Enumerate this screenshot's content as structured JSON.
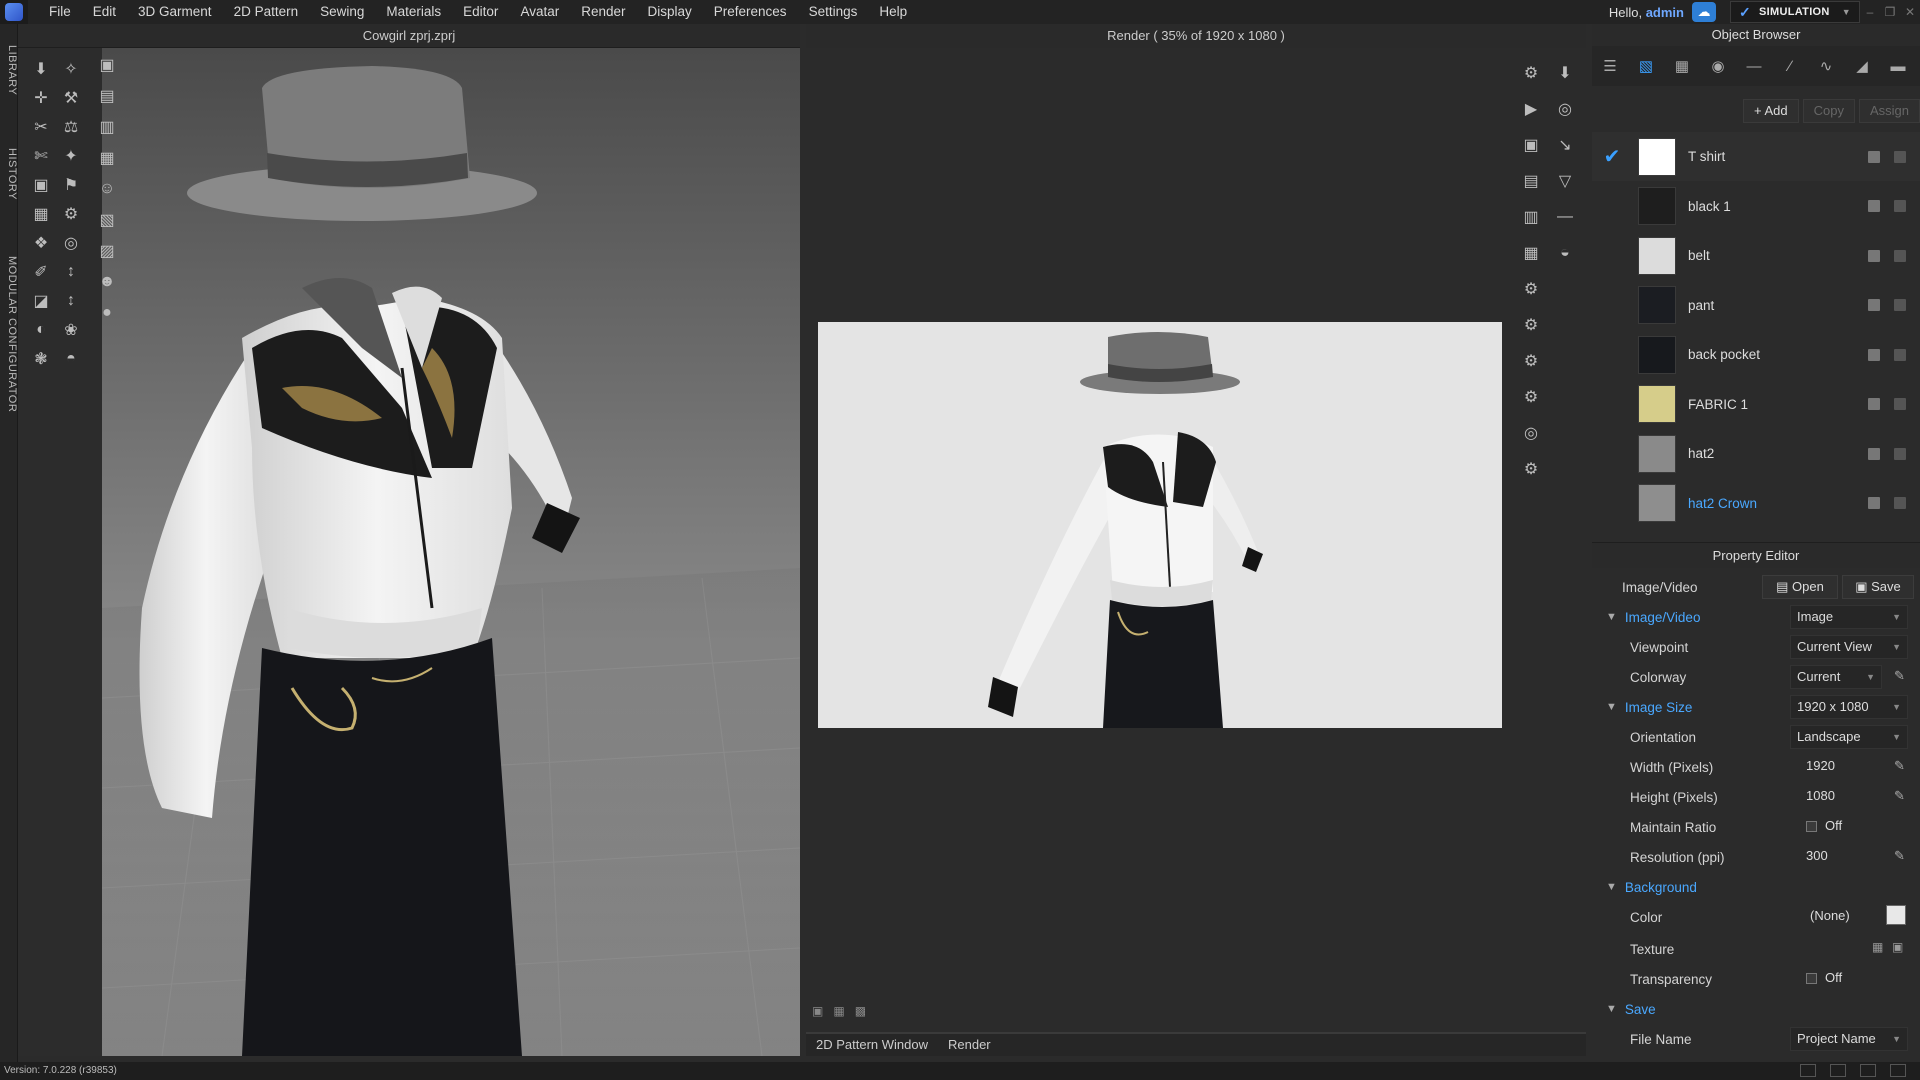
{
  "menu": [
    "File",
    "Edit",
    "3D Garment",
    "2D Pattern",
    "Sewing",
    "Materials",
    "Editor",
    "Avatar",
    "Render",
    "Display",
    "Preferences",
    "Settings",
    "Help"
  ],
  "user": {
    "greeting": "Hello,",
    "name": "admin"
  },
  "simulation": {
    "label": "SIMULATION"
  },
  "left_tabs": [
    "LIBRARY",
    "HISTORY",
    "MODULAR CONFIGURATOR"
  ],
  "viewport3d": {
    "title": "Cowgirl zprj.zprj"
  },
  "render_panel": {
    "title": "Render ( 35% of 1920 x 1080 )"
  },
  "bottom_tabs": [
    "2D Pattern Window",
    "Render"
  ],
  "object_browser": {
    "title": "Object Browser",
    "add": "+ Add",
    "copy": "Copy",
    "assign": "Assign",
    "materials": [
      {
        "name": "T shirt",
        "color": "#ffffff",
        "selected": true,
        "checked": true
      },
      {
        "name": "black 1",
        "color": "#1e1e1e"
      },
      {
        "name": "belt",
        "color": "#dcdcdc"
      },
      {
        "name": "pant",
        "color": "#1b1d22"
      },
      {
        "name": "back pocket",
        "color": "#17191d"
      },
      {
        "name": "FABRIC 1",
        "color": "#d6cd8a"
      },
      {
        "name": "hat2",
        "color": "#8a8a8a"
      },
      {
        "name": "hat2 Crown",
        "color": "#8e8e8e",
        "highlight": true
      }
    ]
  },
  "property_editor": {
    "title": "Property Editor",
    "header_label": "Image/Video",
    "open": "Open",
    "save_btn": "Save",
    "image_video": {
      "label": "Image/Video",
      "value": "Image"
    },
    "viewpoint": {
      "label": "Viewpoint",
      "value": "Current View"
    },
    "colorway": {
      "label": "Colorway",
      "value": "Current"
    },
    "image_size": {
      "label": "Image Size",
      "value": "1920 x 1080"
    },
    "orientation": {
      "label": "Orientation",
      "value": "Landscape"
    },
    "width": {
      "label": "Width (Pixels)",
      "value": "1920"
    },
    "height": {
      "label": "Height (Pixels)",
      "value": "1080"
    },
    "maintain_ratio": {
      "label": "Maintain Ratio",
      "value": "Off"
    },
    "resolution": {
      "label": "Resolution (ppi)",
      "value": "300"
    },
    "background": {
      "label": "Background"
    },
    "color": {
      "label": "Color",
      "value": "(None)"
    },
    "texture": {
      "label": "Texture"
    },
    "transparency": {
      "label": "Transparency",
      "value": "Off"
    },
    "save_section": {
      "label": "Save"
    },
    "file_name": {
      "label": "File Name",
      "value": "Project Name"
    }
  },
  "status": {
    "version": "Version: 7.0.228 (r39853)"
  }
}
